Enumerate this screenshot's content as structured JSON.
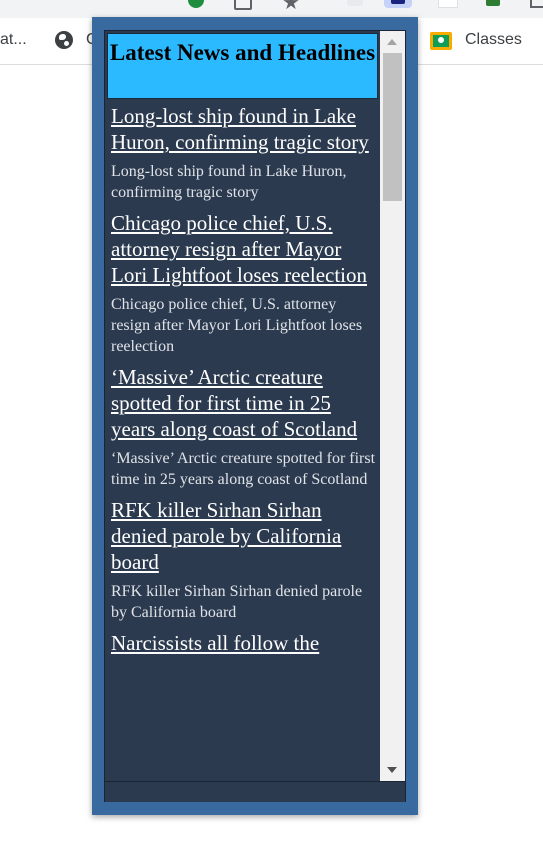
{
  "bookmarks": {
    "cut_label": "at...",
    "partial_label": "G",
    "classes_label": "Classes"
  },
  "popup": {
    "header": "Latest News and Headlines",
    "articles": [
      {
        "title": "Long-lost ship found in Lake Huron, confirming tragic story",
        "summary": "Long-lost ship found in Lake Huron, confirming tragic story"
      },
      {
        "title": "Chicago police chief, U.S. attorney resign after Mayor Lori Lightfoot loses reelection",
        "summary": "Chicago police chief, U.S. attorney resign after Mayor Lori Lightfoot loses reelection"
      },
      {
        "title": "‘Massive’ Arctic creature spotted for first time in 25 years along coast of Scotland",
        "summary": "‘Massive’ Arctic creature spotted for first time in 25 years along coast of Scotland"
      },
      {
        "title": "RFK killer Sirhan Sirhan denied parole by California board",
        "summary": "RFK killer Sirhan Sirhan denied parole by California board"
      },
      {
        "title": "Narcissists all follow the"
      }
    ]
  },
  "colors": {
    "popup_frame": "#386aa0",
    "panel_bg": "#2b3a4f",
    "header_bg": "#2bbaff"
  }
}
